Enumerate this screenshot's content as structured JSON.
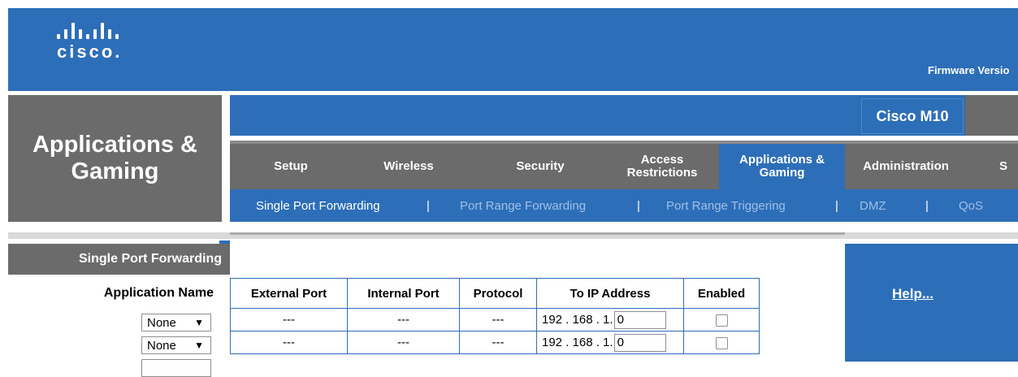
{
  "brand": {
    "name": "cisco."
  },
  "header": {
    "firmware_label": "Firmware Versio"
  },
  "section_title": "Applications & Gaming",
  "model": "Cisco M10",
  "tabs": [
    {
      "label": "Setup",
      "active": false
    },
    {
      "label": "Wireless",
      "active": false
    },
    {
      "label": "Security",
      "active": false
    },
    {
      "label": "Access Restrictions",
      "active": false
    },
    {
      "label": "Applications & Gaming",
      "active": true
    },
    {
      "label": "Administration",
      "active": false
    },
    {
      "label": "S",
      "active": false
    }
  ],
  "subnav": [
    {
      "label": "Single Port Forwarding",
      "active": true
    },
    {
      "label": "Port Range Forwarding",
      "active": false
    },
    {
      "label": "Port Range Triggering",
      "active": false
    },
    {
      "label": "DMZ",
      "active": false
    },
    {
      "label": "QoS",
      "active": false
    }
  ],
  "subnav_separator": "|",
  "sidebar": {
    "section_label": "Single Port Forwarding",
    "app_name_label": "Application Name",
    "dropdowns": [
      {
        "value": "None"
      },
      {
        "value": "None"
      }
    ]
  },
  "table": {
    "headers": [
      "External Port",
      "Internal Port",
      "Protocol",
      "To IP Address",
      "Enabled"
    ],
    "rows": [
      {
        "external": "---",
        "internal": "---",
        "protocol": "---",
        "ip_prefix": "192 . 168 . 1.",
        "ip_last": "0",
        "enabled": false
      },
      {
        "external": "---",
        "internal": "---",
        "protocol": "---",
        "ip_prefix": "192 . 168 . 1.",
        "ip_last": "0",
        "enabled": false
      }
    ]
  },
  "help": {
    "label": "Help..."
  },
  "colors": {
    "primary_blue": "#2d6eb8",
    "dark_gray": "#6b6b6b",
    "inactive_subnav": "#9fbfe8"
  }
}
